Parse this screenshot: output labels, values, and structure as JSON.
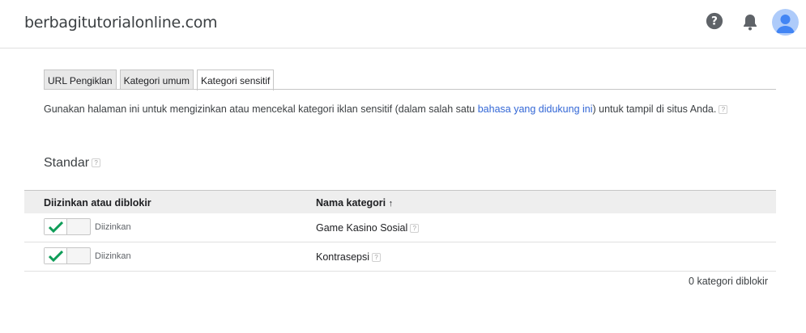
{
  "header": {
    "site_title": "berbagitutorialonline.com",
    "icons": [
      "help-icon",
      "bell-icon",
      "account-avatar"
    ]
  },
  "tabs": [
    {
      "label": "URL Pengiklan",
      "active": false
    },
    {
      "label": "Kategori umum",
      "active": false
    },
    {
      "label": "Kategori sensitif",
      "active": true
    }
  ],
  "description": {
    "before": "Gunakan halaman ini untuk mengizinkan atau mencekal kategori iklan sensitif (dalam salah satu ",
    "link": "bahasa yang didukung ini",
    "after": ") untuk tampil di situs Anda."
  },
  "section": {
    "title": "Standar"
  },
  "table": {
    "columns": [
      "Diizinkan atau diblokir",
      "Nama kategori"
    ],
    "sort_indicator": "↑",
    "rows": [
      {
        "status": "Diizinkan",
        "category": "Game Kasino Sosial"
      },
      {
        "status": "Diizinkan",
        "category": "Kontrasepsi"
      }
    ]
  },
  "footer": {
    "blocked_count": "0 kategori diblokir"
  },
  "colors": {
    "check": "#0f9d58",
    "link": "#3367d6",
    "avatar_bg": "#aecbfa",
    "avatar_fg": "#4285f4"
  }
}
